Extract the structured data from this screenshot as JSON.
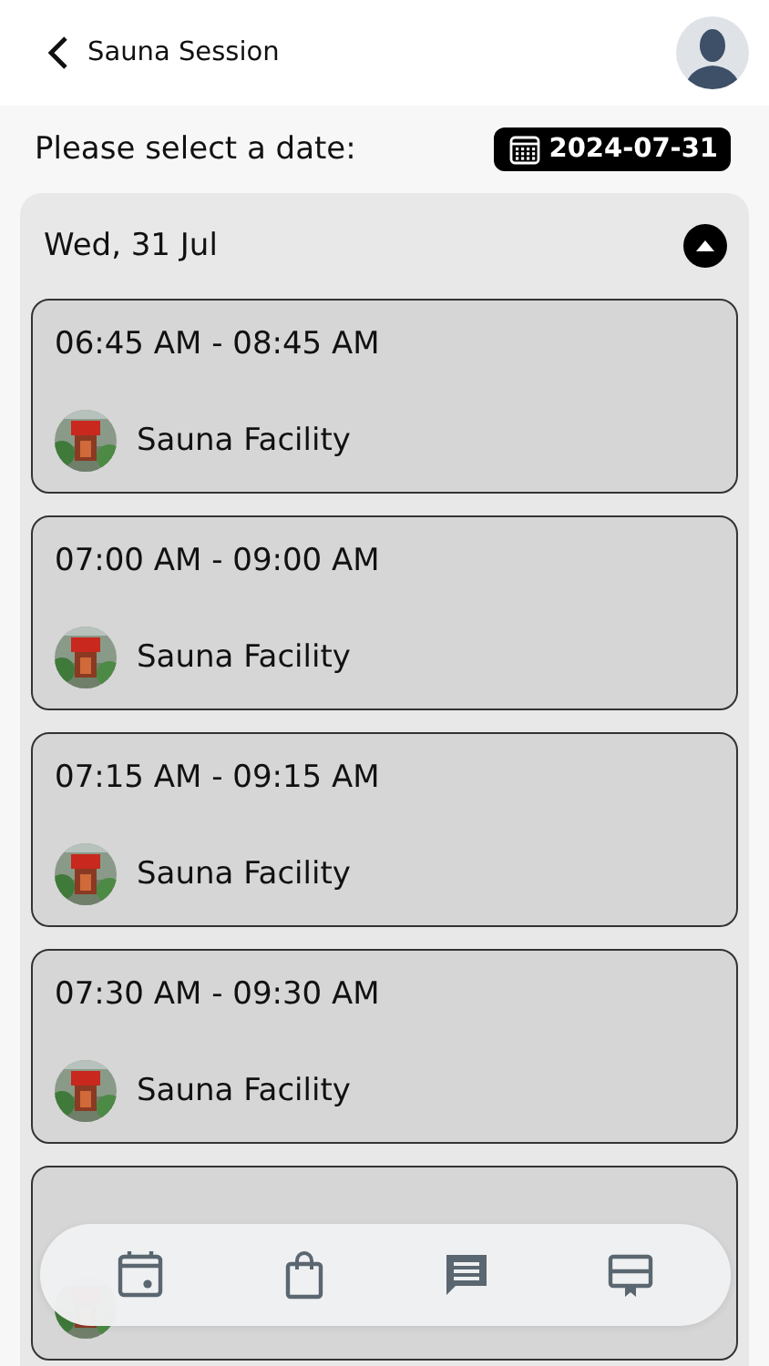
{
  "header": {
    "title": "Sauna Session"
  },
  "date_picker": {
    "label": "Please select a date:",
    "value": "2024-07-31"
  },
  "day_group": {
    "title": "Wed, 31 Jul",
    "expanded": true
  },
  "sessions": [
    {
      "time": "06:45 AM - 08:45 AM",
      "facility": "Sauna Facility"
    },
    {
      "time": "07:00 AM - 09:00 AM",
      "facility": "Sauna Facility"
    },
    {
      "time": "07:15 AM - 09:15 AM",
      "facility": "Sauna Facility"
    },
    {
      "time": "07:30 AM - 09:30 AM",
      "facility": "Sauna Facility"
    },
    {
      "kind": "picture"
    }
  ]
}
